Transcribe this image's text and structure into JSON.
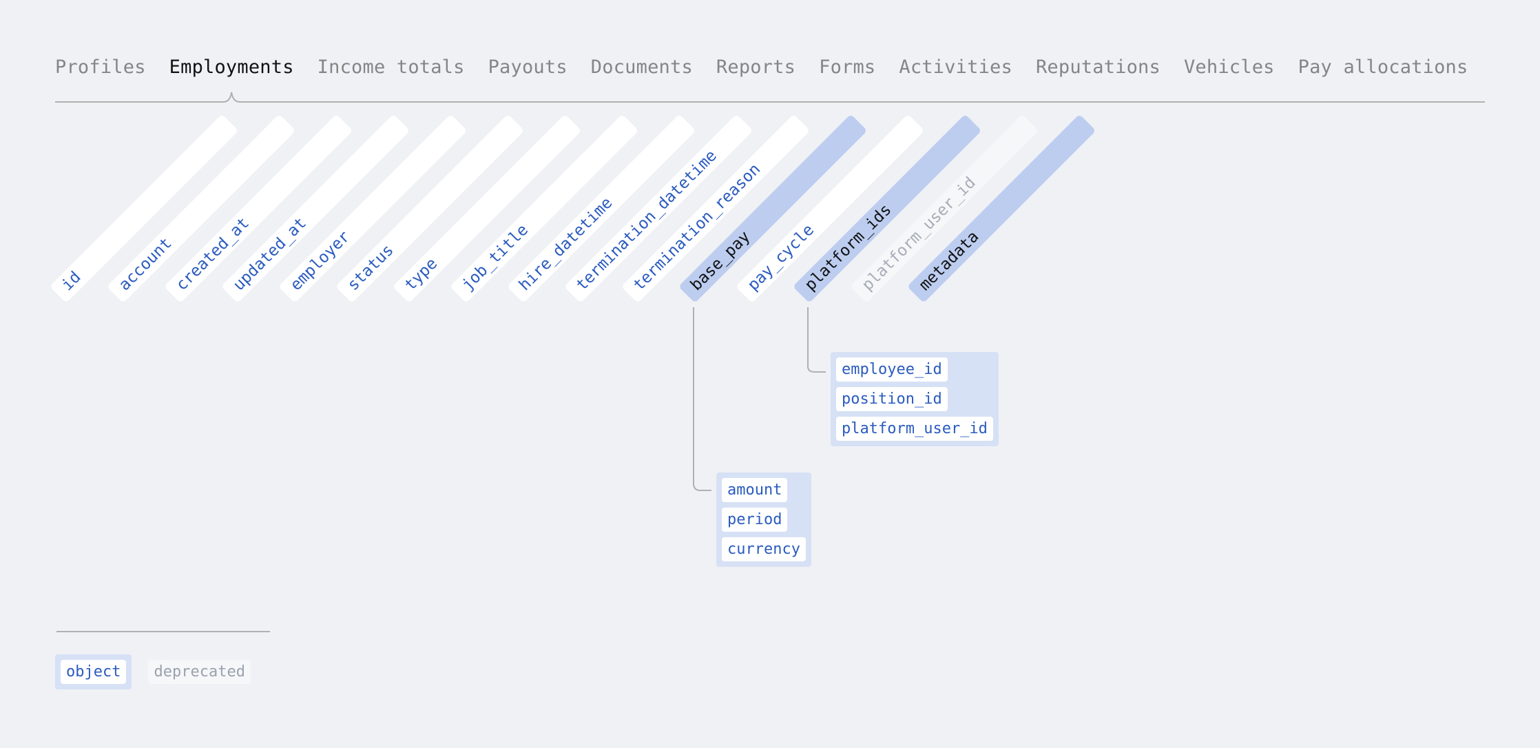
{
  "tabs": [
    {
      "label": "Profiles",
      "active": false
    },
    {
      "label": "Employments",
      "active": true
    },
    {
      "label": "Income totals",
      "active": false
    },
    {
      "label": "Payouts",
      "active": false
    },
    {
      "label": "Documents",
      "active": false
    },
    {
      "label": "Reports",
      "active": false
    },
    {
      "label": "Forms",
      "active": false
    },
    {
      "label": "Activities",
      "active": false
    },
    {
      "label": "Reputations",
      "active": false
    },
    {
      "label": "Vehicles",
      "active": false
    },
    {
      "label": "Pay allocations",
      "active": false
    }
  ],
  "fields": [
    {
      "name": "id",
      "kind": "plain"
    },
    {
      "name": "account",
      "kind": "plain"
    },
    {
      "name": "created_at",
      "kind": "plain"
    },
    {
      "name": "updated_at",
      "kind": "plain"
    },
    {
      "name": "employer",
      "kind": "plain"
    },
    {
      "name": "status",
      "kind": "plain"
    },
    {
      "name": "type",
      "kind": "plain"
    },
    {
      "name": "job_title",
      "kind": "plain"
    },
    {
      "name": "hire_datetime",
      "kind": "plain"
    },
    {
      "name": "termination_datetime",
      "kind": "plain"
    },
    {
      "name": "termination_reason",
      "kind": "plain"
    },
    {
      "name": "base_pay",
      "kind": "object"
    },
    {
      "name": "pay_cycle",
      "kind": "plain"
    },
    {
      "name": "platform_ids",
      "kind": "object"
    },
    {
      "name": "platform_user_id",
      "kind": "deprecated"
    },
    {
      "name": "metadata",
      "kind": "object"
    }
  ],
  "subfields": {
    "platform_ids": [
      "employee_id",
      "position_id",
      "platform_user_id"
    ],
    "base_pay": [
      "amount",
      "period",
      "currency"
    ]
  },
  "legend": {
    "object_label": "object",
    "deprecated_label": "deprecated"
  },
  "colors": {
    "background": "#f0f1f5",
    "field_text": "#2a5bbf",
    "object_fill": "#bccdf0",
    "object_group_fill": "#d7e1f5",
    "deprecated_fill": "#f6f7f9",
    "deprecated_text": "#a7adb8",
    "rule": "#b0b0b0"
  }
}
